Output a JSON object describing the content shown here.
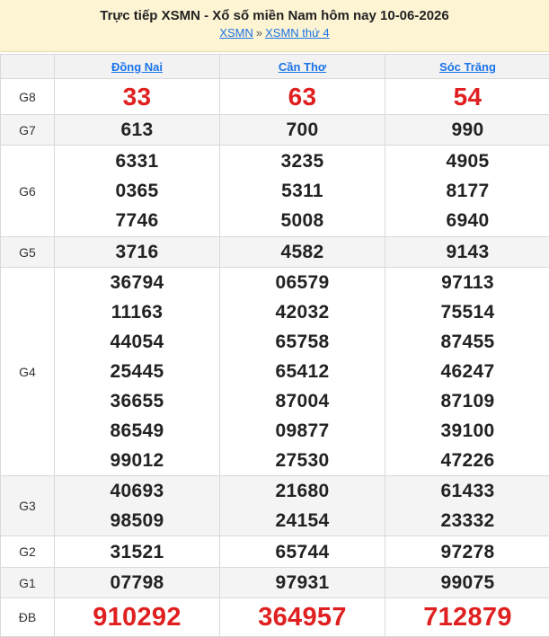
{
  "header": {
    "title": "Trực tiếp XSMN - Xổ số miền Nam hôm nay 10-06-2026",
    "breadcrumb": {
      "home": "XSMN",
      "separator": "»",
      "current": "XSMN thứ 4"
    }
  },
  "colors": {
    "header_bg": "#fdf4d3",
    "link": "#1a73e8",
    "highlight": "#e02020"
  },
  "provinces": [
    "Đồng Nai",
    "Cần Thơ",
    "Sóc Trăng"
  ],
  "prizes": [
    {
      "label": "G8",
      "values": [
        [
          "33"
        ],
        [
          "63"
        ],
        [
          "54"
        ]
      ]
    },
    {
      "label": "G7",
      "values": [
        [
          "613"
        ],
        [
          "700"
        ],
        [
          "990"
        ]
      ]
    },
    {
      "label": "G6",
      "values": [
        [
          "6331",
          "0365",
          "7746"
        ],
        [
          "3235",
          "5311",
          "5008"
        ],
        [
          "4905",
          "8177",
          "6940"
        ]
      ]
    },
    {
      "label": "G5",
      "values": [
        [
          "3716"
        ],
        [
          "4582"
        ],
        [
          "9143"
        ]
      ]
    },
    {
      "label": "G4",
      "values": [
        [
          "36794",
          "11163",
          "44054",
          "25445",
          "36655",
          "86549",
          "99012"
        ],
        [
          "06579",
          "42032",
          "65758",
          "65412",
          "87004",
          "09877",
          "27530"
        ],
        [
          "97113",
          "75514",
          "87455",
          "46247",
          "87109",
          "39100",
          "47226"
        ]
      ]
    },
    {
      "label": "G3",
      "values": [
        [
          "40693",
          "98509"
        ],
        [
          "21680",
          "24154"
        ],
        [
          "61433",
          "23332"
        ]
      ]
    },
    {
      "label": "G2",
      "values": [
        [
          "31521"
        ],
        [
          "65744"
        ],
        [
          "97278"
        ]
      ]
    },
    {
      "label": "G1",
      "values": [
        [
          "07798"
        ],
        [
          "97931"
        ],
        [
          "99075"
        ]
      ]
    },
    {
      "label": "ĐB",
      "values": [
        [
          "910292"
        ],
        [
          "364957"
        ],
        [
          "712879"
        ]
      ]
    }
  ]
}
